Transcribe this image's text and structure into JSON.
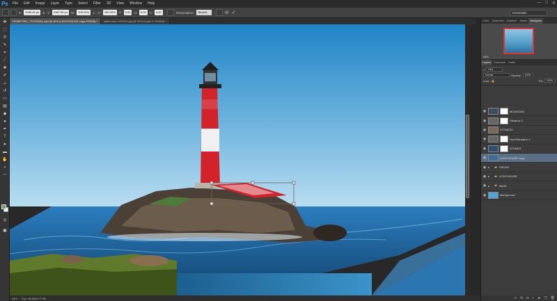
{
  "app": {
    "logo": "Ps"
  },
  "menu": [
    "File",
    "Edit",
    "Image",
    "Layer",
    "Type",
    "Select",
    "Filter",
    "3D",
    "View",
    "Window",
    "Help"
  ],
  "window_controls": [
    "—",
    "□",
    "✕"
  ],
  "options": {
    "x_value": "2595.00 px",
    "y_value": "2467.50 px",
    "w_label": "W:",
    "w_value": "100.00%",
    "h_label": "H:",
    "h_value": "100.00%",
    "angle_value": "0.00",
    "h_skew": "0.00",
    "v_skew": "0.00",
    "interp_label": "Interpolation:",
    "interp_value": "Bicubic",
    "workspace": "Essentials"
  },
  "doc_tabs": [
    {
      "label": "ISOMETRIC_TUTORIAL.psd @ 44% (LIGHTHOUSE copy, RGB/8) *",
      "active": true
    },
    {
      "label": "lighthouse-1421521.jpg @ 34% (Layer 0, RGB/8) *",
      "active": false
    }
  ],
  "status": {
    "zoom": "44%",
    "doc": "Doc: 96.8M/177.3M"
  },
  "panel_tabs_top": [
    "Color",
    "Swatches",
    "Adjustm",
    "Styles",
    "Navigator"
  ],
  "navigator": {
    "zoom": "44%"
  },
  "panel_tabs_layers": [
    "Layers",
    "Channels",
    "Paths"
  ],
  "layer_controls": {
    "kind": "Kind",
    "blend": "Normal",
    "opacity_label": "Opacity:",
    "opacity": "100%",
    "lock_label": "Lock:",
    "fill_label": "Fill:",
    "fill": "100%"
  },
  "layers": [
    {
      "name": "MOUNTAIN",
      "type": "pixel-mask",
      "thumb": "#3b4d5e",
      "selected": false
    },
    {
      "name": "Vibrance 1",
      "type": "adjust",
      "thumb": "#666666",
      "selected": false
    },
    {
      "name": "STONES2",
      "type": "pixel",
      "thumb": "#7a6a55",
      "selected": false
    },
    {
      "name": "Hue/Saturation 1",
      "type": "adjust",
      "thumb": "#666666",
      "selected": false
    },
    {
      "name": "STONES",
      "type": "pixel-mask",
      "thumb": "#2e4f6e",
      "selected": false
    },
    {
      "name": "LIGHTHOUSE copy",
      "type": "pixel",
      "thumb": "#3d6f9e",
      "selected": true
    },
    {
      "name": "ROCKS",
      "type": "folder",
      "thumb": "",
      "selected": false
    },
    {
      "name": "LIGHTHOUSE",
      "type": "folder",
      "thumb": "",
      "selected": false
    },
    {
      "name": "BASE",
      "type": "folder",
      "thumb": "",
      "selected": false
    },
    {
      "name": "Background",
      "type": "pixel",
      "thumb": "#4ea3d8",
      "selected": false
    }
  ],
  "layers_footer_icons": [
    "link-icon",
    "fx-icon",
    "mask-icon",
    "adjust-icon",
    "folder-icon",
    "new-layer-icon",
    "trash-icon"
  ],
  "colors": {
    "sky_top": "#1f84c6",
    "sky_bottom": "#b9ddf0",
    "sea": "#1f6aa8",
    "lighthouse_red": "#d2232a",
    "selection_highlight": "#5a6f86",
    "ps_accent": "#31a8ff"
  }
}
